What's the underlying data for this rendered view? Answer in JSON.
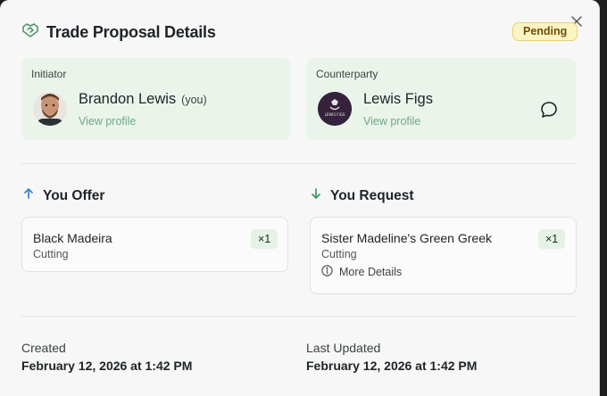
{
  "dialog": {
    "title": "Trade Proposal Details",
    "status": "Pending"
  },
  "initiator": {
    "role": "Initiator",
    "name": "Brandon Lewis",
    "you_tag": "(you)",
    "link": "View profile"
  },
  "counterparty": {
    "role": "Counterparty",
    "name": "Lewis Figs",
    "link": "View profile",
    "avatar_text": "LEWIS FIGS"
  },
  "offer": {
    "heading": "You Offer",
    "items": [
      {
        "name": "Black Madeira",
        "type": "Cutting",
        "qty": "×1"
      }
    ]
  },
  "request": {
    "heading": "You Request",
    "items": [
      {
        "name": "Sister Madeline's Green Greek",
        "type": "Cutting",
        "qty": "×1",
        "more": "More Details"
      }
    ]
  },
  "meta": {
    "created_label": "Created",
    "created_value": "February 12, 2026 at 1:42 PM",
    "updated_label": "Last Updated",
    "updated_value": "February 12, 2026 at 1:42 PM"
  },
  "colors": {
    "accent_green": "#4f9a6a",
    "up_arrow": "#3b7fd1",
    "pending_bg": "#fdf4c4"
  }
}
